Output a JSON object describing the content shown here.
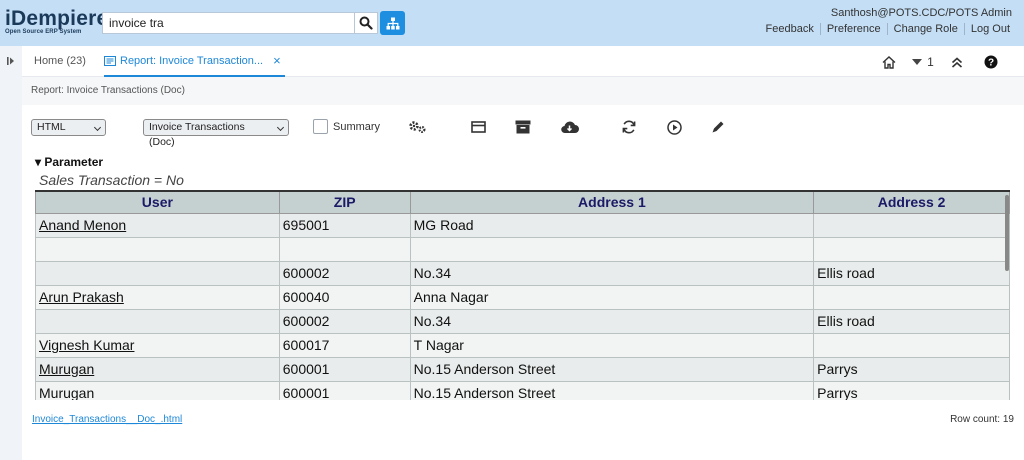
{
  "header": {
    "logo_main": "iDempiere",
    "logo_sub": "Open Source ERP System",
    "search_value": "invoice tra",
    "user": "Santhosh@POTS.CDC/POTS Admin",
    "links": [
      "Feedback",
      "Preference",
      "Change Role",
      "Log Out"
    ]
  },
  "tabs": {
    "home": "Home (23)",
    "report": "Report: Invoice Transaction...",
    "close": "×"
  },
  "right_icons": {
    "count": "1"
  },
  "breadcrumb": "Report: Invoice Transactions (Doc)",
  "toolbar": {
    "format": "HTML",
    "print_format": "Invoice Transactions (Doc)",
    "summary_label": "Summary",
    "summary_checked": false,
    "icons": [
      "settings-icon",
      "email-icon",
      "archive-icon",
      "download-icon",
      "refresh-icon",
      "run-icon",
      "edit-icon"
    ]
  },
  "parameter": {
    "heading": "Parameter",
    "text": "Sales Transaction = No"
  },
  "table": {
    "columns": [
      "User",
      "ZIP",
      "Address 1",
      "Address 2"
    ],
    "rows": [
      [
        "Anand Menon",
        "695001",
        "MG Road",
        ""
      ],
      [
        "",
        "",
        "",
        ""
      ],
      [
        "",
        "600002",
        "No.34",
        "Ellis road"
      ],
      [
        "Arun Prakash",
        "600040",
        "Anna Nagar",
        ""
      ],
      [
        "",
        "600002",
        "No.34",
        "Ellis road"
      ],
      [
        "Vignesh Kumar",
        "600017",
        "T Nagar",
        ""
      ],
      [
        "Murugan",
        "600001",
        "No.15 Anderson Street",
        "Parrys"
      ],
      [
        "Murugan",
        "600001",
        "No.15 Anderson Street",
        "Parrys"
      ]
    ]
  },
  "footer": {
    "link": "Invoice_Transactions__Doc_.html",
    "row_count": "Row count: 19"
  },
  "colors": {
    "header_bg": "#c3def5",
    "accent": "#1e88d8",
    "table_header": "#c5d1d1"
  }
}
